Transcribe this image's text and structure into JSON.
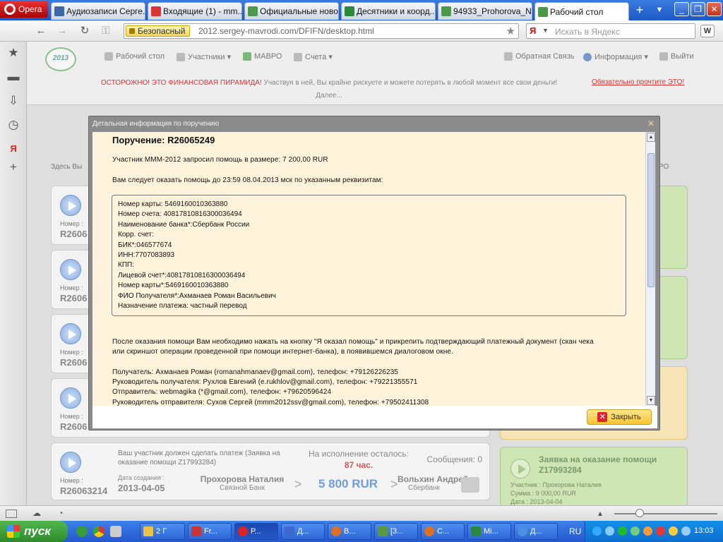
{
  "browser": {
    "opera_label": "Opera",
    "tabs": [
      {
        "label": "Аудиозаписи Серге...",
        "color": "#3b68a8"
      },
      {
        "label": "Входящие (1) - mm...",
        "color": "#d33"
      },
      {
        "label": "Официальные ново...",
        "color": "#4a9a4a"
      },
      {
        "label": "Десятники и коорд...",
        "color": "#2a8a3a"
      },
      {
        "label": "94933_Prohorova_N...",
        "color": "#4a9a4a"
      },
      {
        "label": "Рабочий стол",
        "color": "#4a9a4a"
      }
    ],
    "new_tab_glyph": "+",
    "tab_menu_glyph": "▼",
    "window_buttons": [
      "_",
      "❐",
      "✕"
    ],
    "nav": {
      "back": "←",
      "forward": "→",
      "reload": "↻",
      "key": "⚿"
    },
    "secure_label": "Безопасный",
    "url": "2012.sergey-mavrodi.com/DFIFN/desktop.html",
    "bookmark_glyph": "★",
    "search_logo": "Я",
    "search_caret": "▼",
    "search_placeholder": "Искать в Яндекс",
    "wot_label": "W",
    "side_panel_icons": [
      {
        "name": "bookmarks-star-icon",
        "glyph": "★"
      },
      {
        "name": "notes-icon",
        "glyph": "▬"
      },
      {
        "name": "downloads-icon",
        "glyph": "⇩"
      },
      {
        "name": "history-clock-icon",
        "glyph": "◷"
      },
      {
        "name": "yandex-icon",
        "glyph": "Я"
      },
      {
        "name": "add-panel-icon",
        "glyph": "+"
      }
    ]
  },
  "site": {
    "logo_text": "2013",
    "nav_left": [
      "Рабочий стол",
      "Участники ▾",
      "МАВРО",
      "Счета ▾"
    ],
    "nav_right": [
      "Обратная Связь",
      "Информация ▾",
      "Выйти"
    ],
    "warning_red": "ОСТОРОЖНО! ЭТО ФИНАНСОВАЯ ПИРАМИДА!",
    "warning_text": " Участвуя в ней, Вы крайне рискуете и можете потерять в любой момент все свои деньги! Далее...",
    "warning_link": "Обязательно прочтите ЭТО!",
    "here_text": "Здесь Вы",
    "right_label": "РО",
    "card_number_label": "Номер :",
    "card_number_partial": "R2606"
  },
  "bottom_card": {
    "description": "Ваш участник должен сделать платеж (Заявка на оказание помощи Z17993284)",
    "remaining_label": "На исполнение осталось:",
    "remaining_hours": "87 час.",
    "messages": "Сообщения: 0",
    "number_label": "Номер :",
    "number": "R26063214",
    "date_label": "Дата создания :",
    "date": "2013-04-05",
    "from_name": "Прохорова Наталия",
    "from_bank": "Связной Банк",
    "arrow": ">",
    "amount": "5 800 RUR",
    "to_name": "Вольхин Андрей",
    "to_bank": "Сбербанк"
  },
  "green_card": {
    "title": "Заявка на оказание помощи Z17993284",
    "participant": "Участник : Прохорова Наталия",
    "sum": "Сумма : 9 000,00 RUR",
    "date": "Дата : 2013-04-04"
  },
  "modal": {
    "title": "Детальная информация по поручению",
    "close_x": "✕",
    "heading": "Поручение: R26065249",
    "line1": "Участник МММ-2012 запросил помощь в размере: 7 200,00 RUR",
    "line2": "Вам следует оказать помощь до 23:59 08.04.2013 мск по указанным реквизитам:",
    "requisites": [
      "Номер карты: 5469160010363880",
      "Номер счета: 40817810816300036494",
      "Наименование банка*:Сбербанк России",
      "Корр. счет:",
      "БИК*:046577674",
      "ИНН:7707083893",
      "КПП:",
      "Лицевой счет*:40817810816300036494",
      "Номер карты*:5469160010363880",
      "ФИО Получателя*:Ахманаев Роман Васильевич",
      "Назначение платежа: частный перевод"
    ],
    "after_line1": "После оказания помощи Вам необходимо нажать на кнопку \"Я оказал помощь\" и прикрепить подтверждающий платежный документ (скан чека",
    "after_line2": "или скриншот операции проведенной при помощи интернет-банка), в появившемся диалоговом окне.",
    "contacts": [
      "Получатель: Ахманаев Роман (romanahmanaev@gmail.com), телефон: +79126226235",
      "Руководитель получателя: Рухлов Евгений (e.rukhlov@gmail.com), телефон: +79221355571",
      "Отправитель: webmagika (*@gmail.com), телефон: +79620596424",
      "Руководитель отправителя: Сухов Сергей (mmm2012ssv@gmail.com), телефон: +79502411308"
    ],
    "close_button": "Закрыть",
    "close_button_x": "✕",
    "scroll_up": "▲",
    "scroll_down": "▼"
  },
  "taskbar": {
    "start_label": "пуск",
    "items": [
      {
        "label": "2 Г",
        "color": "#f0c040"
      },
      {
        "label": "Fr...",
        "color": "#c33"
      },
      {
        "label": "Р...",
        "color": "#d22"
      },
      {
        "label": "Д...",
        "color": "#3a6ad0"
      },
      {
        "label": "В...",
        "color": "#e07020"
      },
      {
        "label": "[3...",
        "color": "#5a9a3a"
      },
      {
        "label": "С...",
        "color": "#e07020"
      },
      {
        "label": "Mi...",
        "color": "#2a8a3a"
      },
      {
        "label": "Д...",
        "color": "#4a8fe0"
      }
    ],
    "lang": "RU",
    "clock": "13:03"
  }
}
